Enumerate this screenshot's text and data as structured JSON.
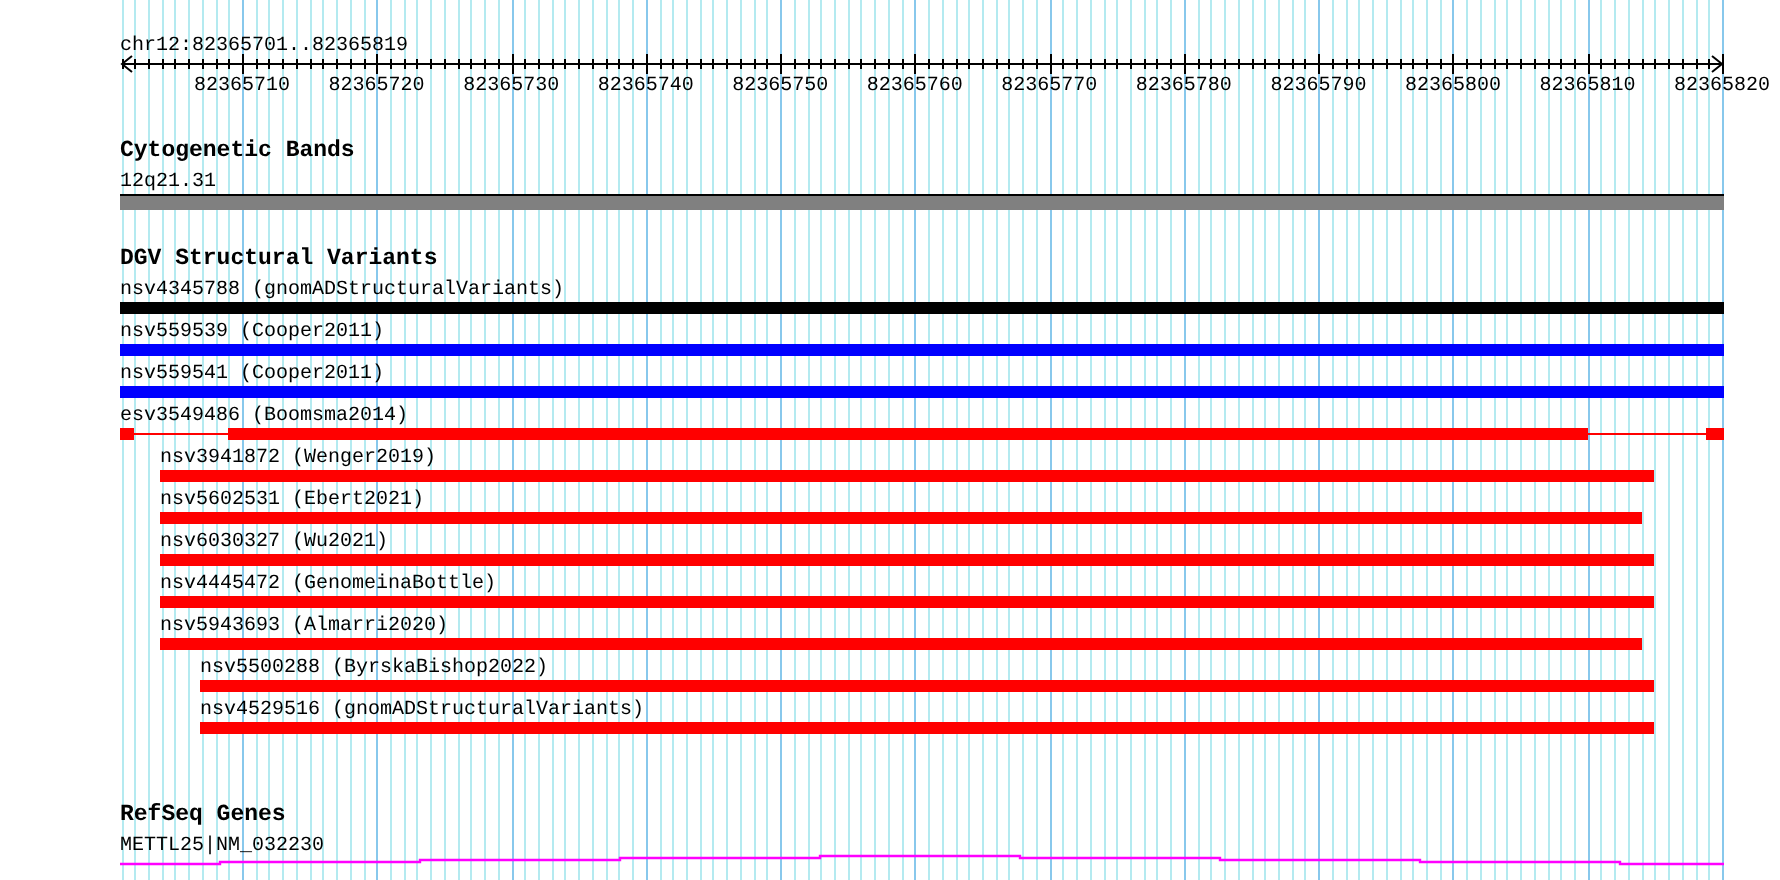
{
  "ruler": {
    "range": "chr12:82365701..82365819",
    "ticks": [
      "82365710",
      "82365720",
      "82365730",
      "82365740",
      "82365750",
      "82365760",
      "82365770",
      "82365780",
      "82365790",
      "82365800",
      "82365810",
      "82365820"
    ]
  },
  "tracks": [
    {
      "kind": "cytoband",
      "title": "Cytogenetic Bands",
      "features": [
        {
          "label": "12q21.31"
        }
      ]
    },
    {
      "kind": "variants",
      "title": "DGV Structural Variants",
      "features": [
        {
          "label": "nsv4345788 (gnomADStructuralVariants)",
          "color": "#000000",
          "kind": "block"
        },
        {
          "label": "nsv559539 (Cooper2011)",
          "color": "#0000ff",
          "kind": "block"
        },
        {
          "label": "nsv559541 (Cooper2011)",
          "color": "#0000ff",
          "kind": "block"
        },
        {
          "label": "esv3549486 (Boomsma2014)",
          "color": "#ff0000",
          "kind": "split"
        },
        {
          "label": "nsv3941872 (Wenger2019)",
          "color": "#ff0000",
          "kind": "block"
        },
        {
          "label": "nsv5602531 (Ebert2021)",
          "color": "#ff0000",
          "kind": "block"
        },
        {
          "label": "nsv6030327 (Wu2021)",
          "color": "#ff0000",
          "kind": "block"
        },
        {
          "label": "nsv4445472 (GenomeinaBottle)",
          "color": "#ff0000",
          "kind": "block"
        },
        {
          "label": "nsv5943693 (Almarri2020)",
          "color": "#ff0000",
          "kind": "block"
        },
        {
          "label": "nsv5500288 (ByrskaBishop2022)",
          "color": "#ff0000",
          "kind": "block"
        },
        {
          "label": "nsv4529516 (gnomADStructuralVariants)",
          "color": "#ff0000",
          "kind": "block"
        }
      ]
    },
    {
      "kind": "genes",
      "title": "RefSeq Genes",
      "features": [
        {
          "label": "METTL25|NM_032230"
        }
      ]
    }
  ]
}
